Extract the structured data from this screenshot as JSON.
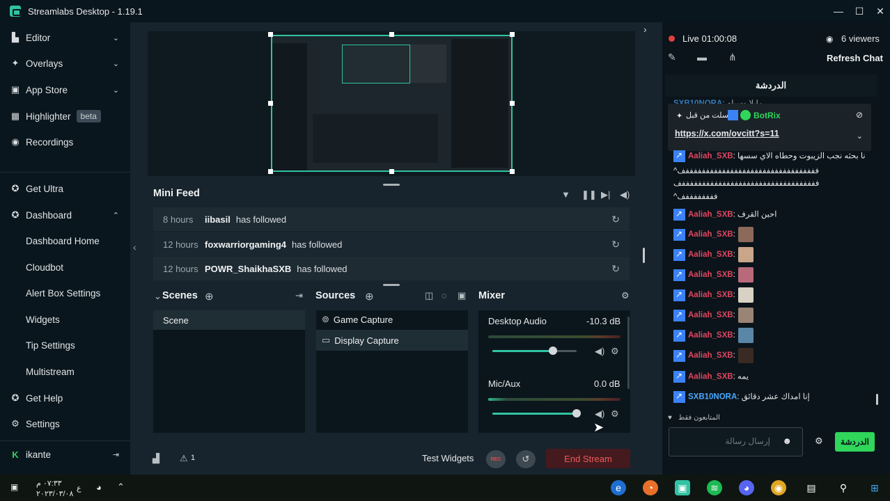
{
  "app": {
    "title": "Streamlabs Desktop - 1.19.1"
  },
  "window_controls": {
    "minimize": "—",
    "maximize": "☐",
    "close": "✕"
  },
  "sidebar": {
    "items": [
      {
        "label": "Editor",
        "icon": "editor-icon"
      },
      {
        "label": "Overlays",
        "icon": "overlays-icon"
      },
      {
        "label": "App Store",
        "icon": "store-icon"
      },
      {
        "label": "Highlighter",
        "icon": "highlighter-icon",
        "badge": "beta"
      },
      {
        "label": "Recordings",
        "icon": "recordings-icon"
      },
      {
        "label": "Get Ultra",
        "icon": "ultra-icon"
      },
      {
        "label": "Dashboard",
        "icon": "dashboard-icon"
      }
    ],
    "dashboard_sub": [
      "Dashboard Home",
      "Cloudbot",
      "Alert Box Settings",
      "Widgets",
      "Tip Settings",
      "Multistream"
    ],
    "bottom": [
      {
        "label": "Get Help",
        "icon": "help-icon"
      },
      {
        "label": "Settings",
        "icon": "settings-icon"
      }
    ],
    "user": "ikante"
  },
  "mini_feed": {
    "title": "Mini Feed",
    "events": [
      {
        "time": "8 hours",
        "user": "iibasil",
        "action": "has followed"
      },
      {
        "time": "12 hours",
        "user": "foxwarriorgaming4",
        "action": "has followed"
      },
      {
        "time": "12 hours",
        "user": "POWR_ShaikhaSXB",
        "action": "has followed"
      }
    ]
  },
  "scenes": {
    "title": "Scenes",
    "items": [
      "Scene"
    ]
  },
  "sources": {
    "title": "Sources",
    "items": [
      "Game Capture",
      "Display Capture"
    ]
  },
  "mixer": {
    "title": "Mixer",
    "channels": [
      {
        "name": "Desktop Audio",
        "db": "-10.3 dB",
        "level": 0.72
      },
      {
        "name": "Mic/Aux",
        "db": "0.0 dB",
        "level": 1.0
      }
    ]
  },
  "footer": {
    "notifications_count": "1",
    "test_widgets": "Test Widgets",
    "rec": "REC",
    "end_stream": "End Stream"
  },
  "chat": {
    "live": "Live 01:00:08",
    "viewers": "6 viewers",
    "refresh": "Refresh Chat",
    "header": "الدردشة",
    "top_partial": {
      "user": "SXB10NORA",
      "text": ": مايلا وسيله"
    },
    "pinned": {
      "bot": "BotRix",
      "label": "أرسلت من قبل",
      "link": "https://x.com/ovcitt?s=11"
    },
    "messages": [
      {
        "user": "Aaliah_SXB",
        "text": ": نا بحثه نجب الزيبوت وحطاه الاي سسها"
      },
      {
        "user": "",
        "text": "^فففففففففففففففففففففففففففففففففف"
      },
      {
        "user": "",
        "text": "ففففففففففففففففففففففففففففففففففف"
      },
      {
        "user": "",
        "text": "^ففففففففف"
      },
      {
        "user": "Aaliah_SXB",
        "text": ": احبن القرف"
      },
      {
        "user": "Aaliah_SXB",
        "text": ":"
      },
      {
        "user": "Aaliah_SXB",
        "text": ":"
      },
      {
        "user": "Aaliah_SXB",
        "text": ":"
      },
      {
        "user": "Aaliah_SXB",
        "text": ":"
      },
      {
        "user": "Aaliah_SXB",
        "text": ":"
      },
      {
        "user": "Aaliah_SXB",
        "text": ":"
      },
      {
        "user": "Aaliah_SXB",
        "text": ":"
      },
      {
        "user": "Aaliah_SXB",
        "text": ": يمه"
      },
      {
        "user": "SXB10NORA",
        "text": ": إنا امداك عشر دقائق"
      }
    ],
    "followers_only": "المتابعون فقط",
    "input_placeholder": "إرسال رسالة",
    "send": "الدردشة"
  },
  "taskbar": {
    "time": "٠٧:٣٣ م",
    "date": "٢٠٢٣/٠٣/٠٨",
    "lang": "ع"
  },
  "colors": {
    "accent": "#31c3a2",
    "live": "#e2403e",
    "end_stream": "#f05b5b",
    "send": "#2fd65a"
  }
}
